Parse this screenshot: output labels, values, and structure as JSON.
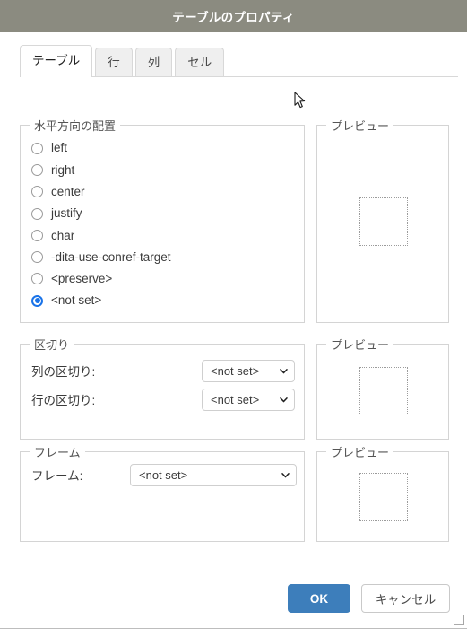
{
  "window": {
    "title": "テーブルのプロパティ",
    "titlebar_color": "#8b8b80"
  },
  "tabs": [
    {
      "label": "テーブル",
      "active": true
    },
    {
      "label": "行",
      "active": false
    },
    {
      "label": "列",
      "active": false
    },
    {
      "label": "セル",
      "active": false
    }
  ],
  "align_group": {
    "legend": "水平方向の配置",
    "options": [
      {
        "label": "left",
        "checked": false
      },
      {
        "label": "right",
        "checked": false
      },
      {
        "label": "center",
        "checked": false
      },
      {
        "label": "justify",
        "checked": false
      },
      {
        "label": "char",
        "checked": false
      },
      {
        "label": "-dita-use-conref-target",
        "checked": false
      },
      {
        "label": "<preserve>",
        "checked": false
      },
      {
        "label": "<not set>",
        "checked": true
      }
    ],
    "selected": "<not set>"
  },
  "separator_group": {
    "legend": "区切り",
    "fields": [
      {
        "label": "列の区切り:",
        "value": "<not set>"
      },
      {
        "label": "行の区切り:",
        "value": "<not set>"
      }
    ]
  },
  "frame_group": {
    "legend": "フレーム",
    "fields": [
      {
        "label": "フレーム:",
        "value": "<not set>"
      }
    ]
  },
  "previews": [
    {
      "legend": "プレビュー"
    },
    {
      "legend": "プレビュー"
    },
    {
      "legend": "プレビュー"
    }
  ],
  "footer": {
    "ok_label": "OK",
    "cancel_label": "キャンセル",
    "ok_color": "#3d7ebb"
  },
  "icons": {
    "chevron_down": "chevron-down-icon",
    "resize_grip": "resize-grip-icon",
    "cursor": "mouse-pointer-icon"
  },
  "colors": {
    "accent": "#1a73e8",
    "primary_button": "#3d7ebb",
    "titlebar": "#8b8b80",
    "border": "#d4d4d4"
  }
}
